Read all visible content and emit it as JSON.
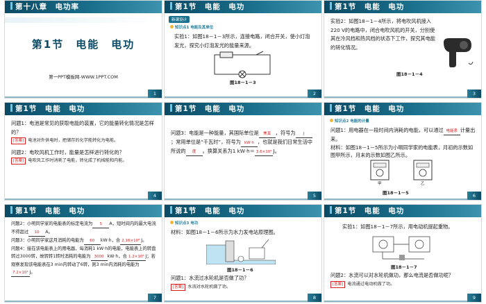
{
  "slides": [
    {
      "id": 1,
      "header": "第十八章　电功率",
      "title": "第1节　电能　电功",
      "url": "第一PPT模板网-WWW.1PPT.COM",
      "number": "1"
    },
    {
      "id": 2,
      "header": "第1节　电能　电功",
      "tag": "新课设计",
      "point": "知识点1  电能及其单位",
      "text": "实验1：如图18－1－3所示，连接电路，闭合开关，使小灯泡发光，探究小灯泡发光的能量来源。",
      "caption": "图18－1－3",
      "number": "2"
    },
    {
      "id": 3,
      "header": "第1节　电能　电功",
      "text": "实验2：如图18－1－4所示，将电吹风机接入220 V的电路中，闭合电吹风机的开关，分别使其在冷风档和热风档的状态下工作，探究其电能的转化情况。",
      "caption": "图18－1－4",
      "number": "3"
    },
    {
      "id": 4,
      "header": "第1节　电能　电功",
      "q1": "问题1：电池是常见的获取电能的装置，它的能量转化情况是怎样的？",
      "a1_label": "[答案]",
      "a1": "电池对外供电时，把储存的化学能转化为电能。",
      "q2": "问题2：电吹风机工作时，能量是怎样进行转化的？",
      "a2_label": "[答案]",
      "a2": "电吹风工作时消耗了电能，转化成了机械能和内能。",
      "number": "4"
    },
    {
      "id": 5,
      "header": "第1节　电能　电功",
      "t1": "问题3：电能是一种能量，其国际单位是",
      "b1": "焦耳",
      "t2": "，符号为",
      "b2": "J",
      "t3": "；常用单位是“千瓦时”，符号为",
      "b3": "kW·h",
      "t4": "，也就是我们日常生活中所说的",
      "b4": "度",
      "t5": "。换算关系为1 kW·h＝",
      "b5": "3.6×10⁶",
      "t6": "J。",
      "number": "5"
    },
    {
      "id": 6,
      "header": "第1节　电能　电功",
      "point": "知识点2  电能的计量",
      "t1": "问题1：用电器在一段时间内消耗的电能，可以通过",
      "b1": "电能表",
      "t2": "计量出来。",
      "t3": "材料：如图18－1－5所示为小明同学家的电能表，月初的示数如图甲所示，月末的示数如图乙所示。",
      "label_a": "甲",
      "label_b": "乙",
      "caption": "图18－1－5",
      "number": "6"
    },
    {
      "id": 7,
      "header": "第1节　电能　电功",
      "t1": "问题2：小明同学家的电能表的标定电流为",
      "b1": "5",
      "t2": "A，短时间内的最大电流不得超过",
      "b2": "10",
      "t3": "A。",
      "t4": "问题3：小明同学家这月消耗的电能为",
      "b3": "60",
      "t5": "kW·h，合",
      "b4": "2.16×10⁸",
      "t6": "J。",
      "t7": "问题4：接在该电能表上的用电器，每消耗1 kW·h的电能，电能表上的转盘转过3000转，故转转1转时消耗的电能为",
      "b5": "3000",
      "t8": "kW·h，合",
      "b6": "1.2×10³",
      "t9": "J；若观察发现该电能表在3 min内转动了6转，则3 min内消耗的电能为",
      "b7": "7.2×10³",
      "t10": "J。",
      "number": "7"
    },
    {
      "id": 8,
      "header": "第1节　电能　电功",
      "point": "知识点3  电功",
      "t1": "材料：如图18－1－6所示为水力发电站原理图。",
      "caption": "图18－1－6",
      "q": "问题1：水流过水轮机是否做了功？",
      "a_label": "[答案]",
      "a": "水流对水轮机做了功。",
      "number": "8"
    },
    {
      "id": 9,
      "header": "第1节　电能　电功",
      "t1": "实验1：如图18－1－7所示，用电动机提起重物。",
      "caption": "图18－1－7",
      "q": "问题2：水流可以对水轮机做功，那么电流是否做功呢？",
      "a_label": "[答案]",
      "a": "电流通过电动机做了功。",
      "number": "9"
    }
  ],
  "colors": {
    "header": "#0b4a64",
    "accent": "#1a6f8c",
    "answer": "#d81e1e"
  }
}
